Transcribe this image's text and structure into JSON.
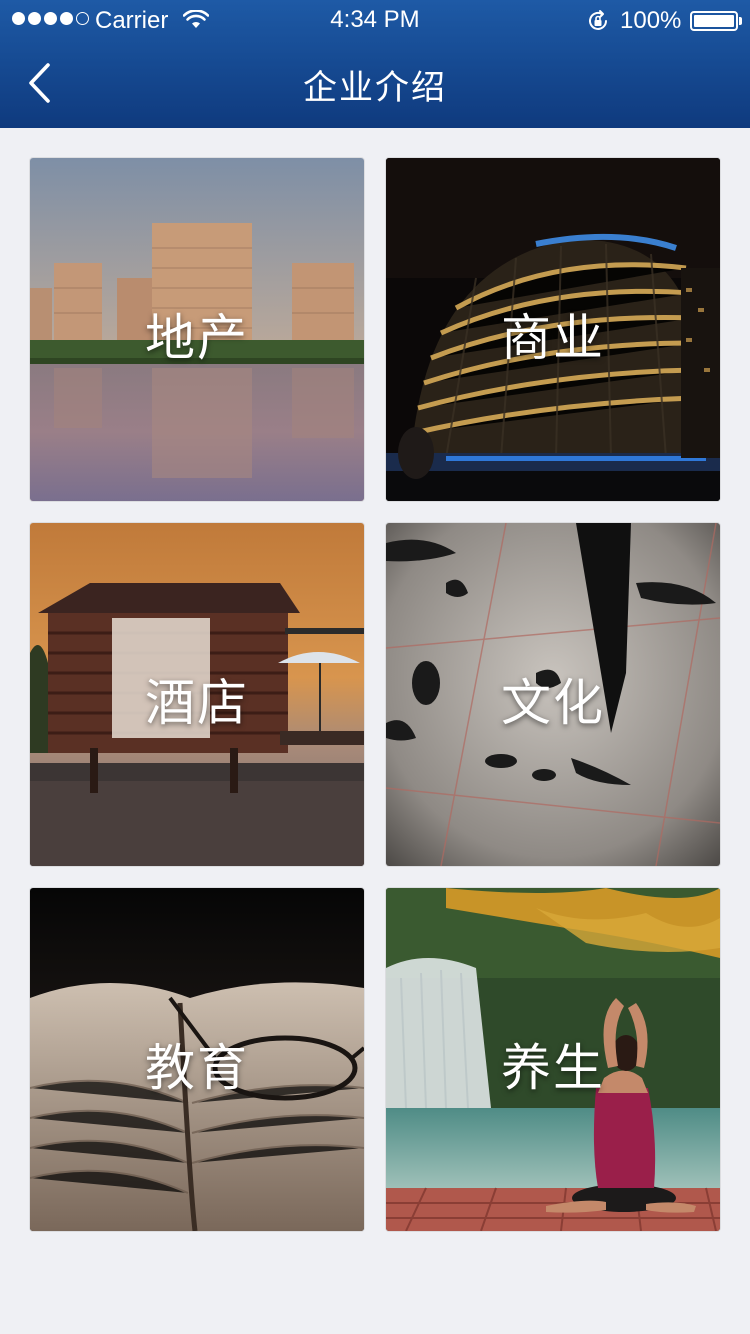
{
  "status_bar": {
    "carrier": "Carrier",
    "time": "4:34 PM",
    "battery": "100%",
    "signal_bars_filled": 4,
    "signal_bars_total": 5
  },
  "nav": {
    "title": "企业介绍",
    "back_icon": "chevron-left-icon"
  },
  "tiles": [
    {
      "label": "地产"
    },
    {
      "label": "商业"
    },
    {
      "label": "酒店"
    },
    {
      "label": "文化"
    },
    {
      "label": "教育"
    },
    {
      "label": "养生"
    }
  ],
  "colors": {
    "header_top": "#1e5aa6",
    "header_bottom": "#0f3a7e",
    "page_background": "#eff0f4",
    "tile_label": "#ffffff"
  }
}
